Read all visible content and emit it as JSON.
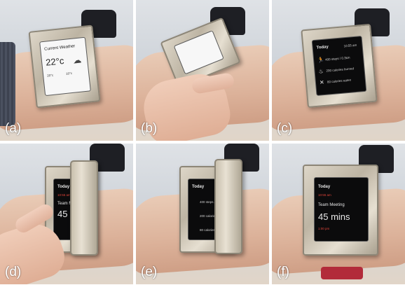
{
  "panels": [
    {
      "label": "(a)"
    },
    {
      "label": "(b)"
    },
    {
      "label": "(c)"
    },
    {
      "label": "(d)"
    },
    {
      "label": "(e)"
    },
    {
      "label": "(f)"
    }
  ],
  "weather_screen": {
    "title": "Current Weather",
    "temp": "22°c",
    "low": "20°c",
    "high": "10°c"
  },
  "today_screen": {
    "heading": "Today",
    "time": "10:55 am",
    "steps": "400 steps / 0.3km",
    "calories": "200 calories burned",
    "eaten": "80 calories eaten"
  },
  "meeting_screen": {
    "heading": "Today",
    "time": "10:55 am",
    "event": "Team Meeting",
    "duration": "45 mins",
    "start": "1:00 pm"
  }
}
